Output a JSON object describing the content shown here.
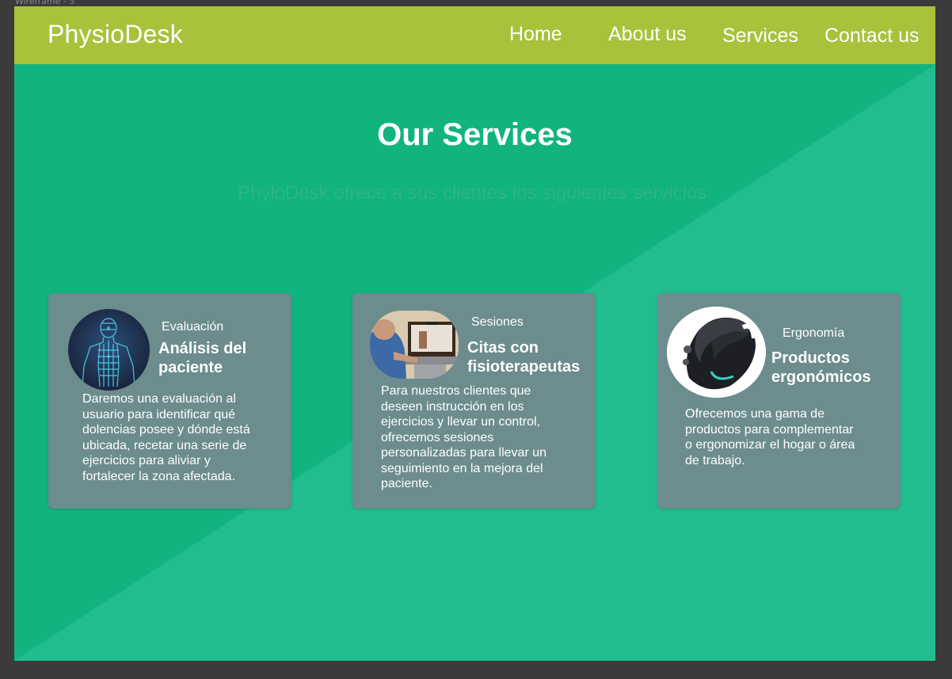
{
  "frame_label": "Wireframe - 5",
  "brand": "PhysioDesk",
  "nav": [
    "Home",
    "About us",
    "Services",
    "Contact us"
  ],
  "section": {
    "title": "Our Services",
    "subtitle": "PhyloDesk ofrece a sus clientes los siguientes servicios."
  },
  "cards": [
    {
      "kicker": "Evaluación",
      "title_line1": "Análisis del",
      "title_line2": "paciente",
      "text": [
        "Daremos una evaluación al",
        "usuario para identificar qué",
        "dolencias posee y dónde está",
        "ubicada, recetar una serie de",
        "ejercicios para aliviar y",
        "fortalecer la zona afectada."
      ],
      "image": "body-scan-image"
    },
    {
      "kicker": "Sesiones",
      "title_line1": "Citas con",
      "title_line2": "fisioterapeutas",
      "text": [
        "Para nuestros clientes que",
        "deseen instrucción en los",
        "ejercicios y llevar un control,",
        "ofrecemos sesiones",
        "personalizadas para llevar un",
        "seguimiento en la mejora del",
        "paciente."
      ],
      "image": "video-session-image"
    },
    {
      "kicker": "Ergonomía",
      "title_line1": "Productos",
      "title_line2": "ergonómicos",
      "text": [
        "Ofrecemos una gama de",
        "productos para complementar",
        "o ergonomizar el hogar o área",
        "de trabajo."
      ],
      "image": "ergonomic-mouse-image"
    }
  ],
  "colors": {
    "navbar": "#a8c23b",
    "background": "#11b47f",
    "card": "#6c8c8e",
    "outer": "#3b3b3b"
  }
}
